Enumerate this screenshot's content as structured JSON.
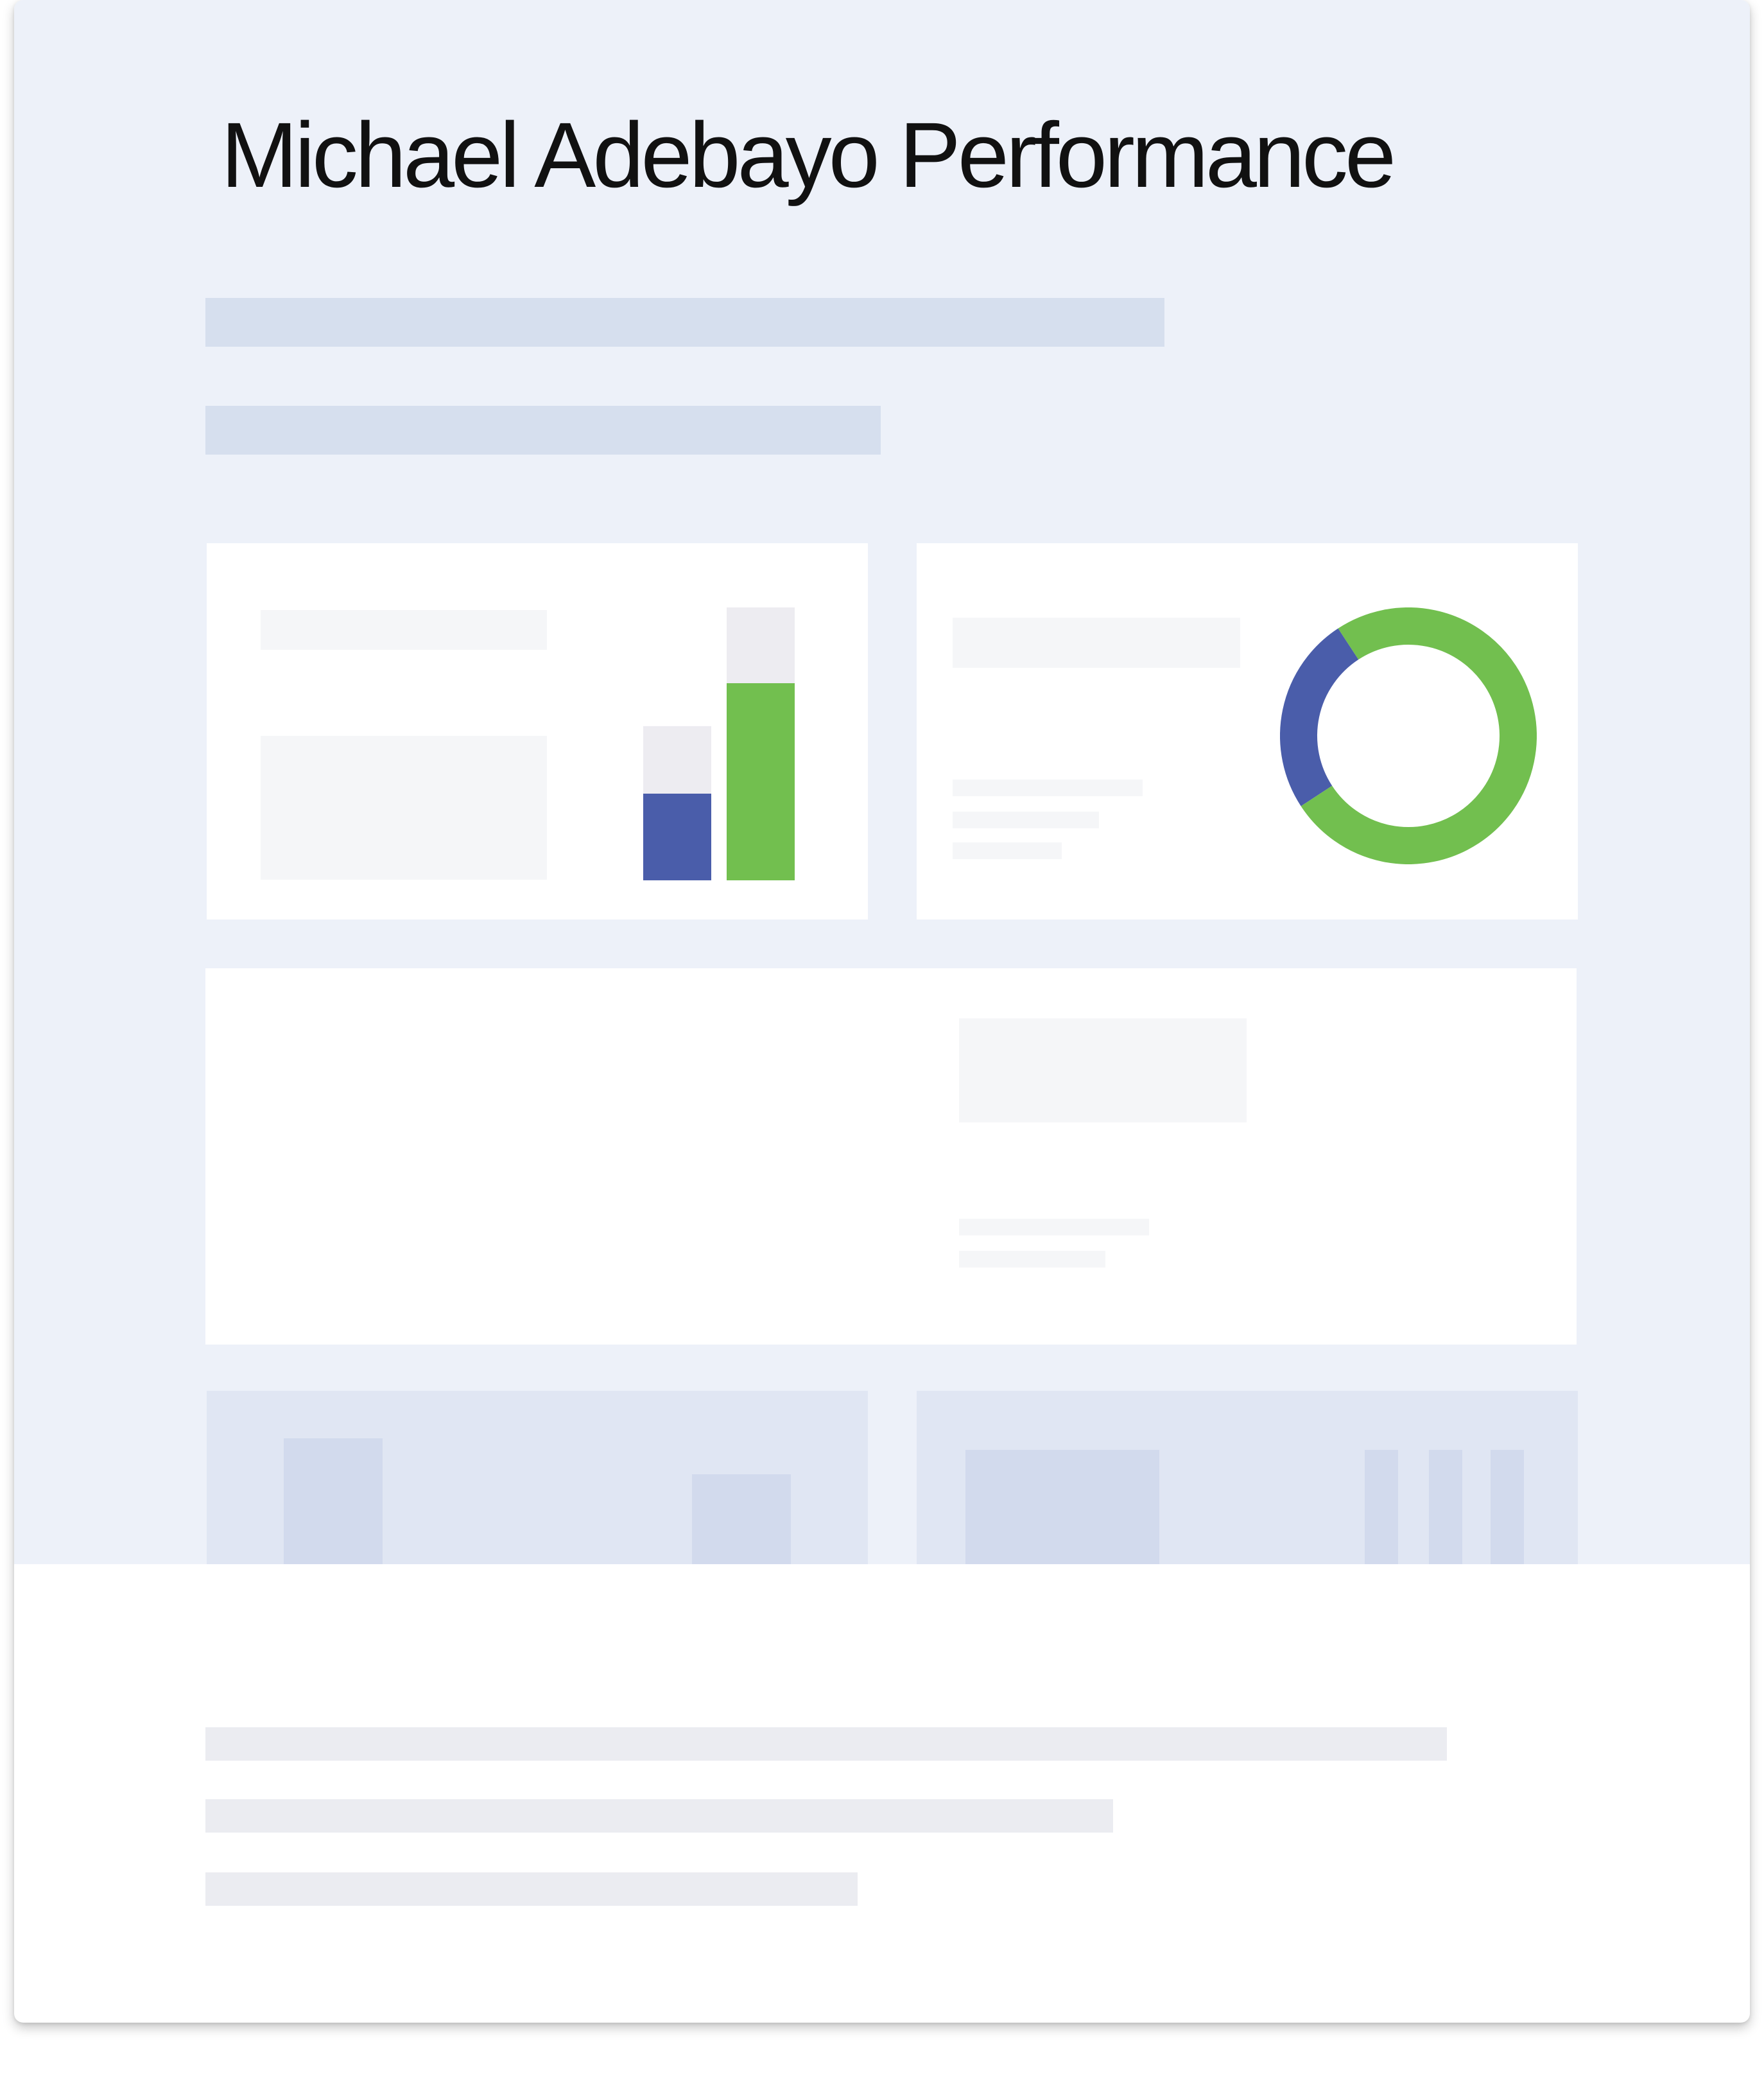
{
  "title": "Michael Adebayo Performance",
  "colors": {
    "page_bg": "#edf1f9",
    "header_skeleton": "#d6dfee",
    "panel_bg": "#ffffff",
    "panel_skeleton": "#f5f6f8",
    "bar_track": "#edecf1",
    "series_blue": "#4a5daa",
    "series_green": "#72bf4f",
    "faded_panel": "#e0e6f3",
    "faded_block": "#d2daed",
    "footer_skeleton": "#ebecf1"
  },
  "chart_data": [
    {
      "type": "bar",
      "categories": [
        "",
        ""
      ],
      "series": [
        {
          "values": [
            0.32,
            0.72
          ],
          "colors": [
            "#4a5daa",
            "#72bf4f"
          ]
        }
      ],
      "ylim": [
        0,
        1
      ],
      "title": "",
      "xlabel": "",
      "ylabel": ""
    },
    {
      "type": "pie",
      "style": "donut",
      "slices": [
        {
          "value": 0.25,
          "color": "#4a5daa"
        },
        {
          "value": 0.75,
          "color": "#72bf4f"
        }
      ],
      "title": ""
    }
  ]
}
